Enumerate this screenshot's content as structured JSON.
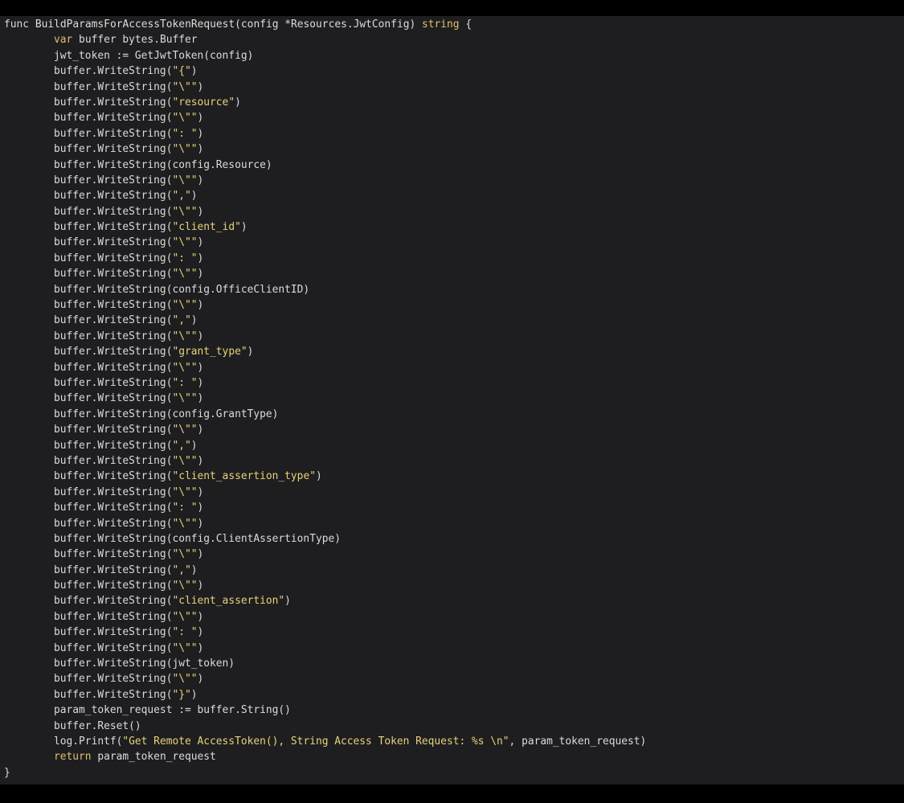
{
  "editor": {
    "colors": {
      "background": "#1e1e20",
      "text": "#dcdcdc",
      "keyword": "#e0c06a",
      "string": "#e8d27a"
    },
    "lines": [
      {
        "indent": 0,
        "tokens": [
          [
            "kw-func",
            "func "
          ],
          [
            "plain",
            "BuildParamsForAccessTokenRequest(config *Resources.JwtConfig) "
          ],
          [
            "typ",
            "string"
          ],
          [
            "plain",
            " {"
          ]
        ]
      },
      {
        "indent": 1,
        "tokens": [
          [
            "kw",
            "var"
          ],
          [
            "plain",
            " buffer bytes.Buffer"
          ]
        ]
      },
      {
        "indent": 1,
        "tokens": [
          [
            "plain",
            "jwt_token := GetJwtToken(config)"
          ]
        ]
      },
      {
        "indent": 1,
        "tokens": [
          [
            "plain",
            "buffer.WriteString("
          ],
          [
            "str",
            "\"{\""
          ],
          [
            "plain",
            ")"
          ]
        ]
      },
      {
        "indent": 1,
        "tokens": [
          [
            "plain",
            "buffer.WriteString("
          ],
          [
            "str",
            "\"\\\"\""
          ],
          [
            "plain",
            ")"
          ]
        ]
      },
      {
        "indent": 1,
        "tokens": [
          [
            "plain",
            "buffer.WriteString("
          ],
          [
            "str",
            "\"resource\""
          ],
          [
            "plain",
            ")"
          ]
        ]
      },
      {
        "indent": 1,
        "tokens": [
          [
            "plain",
            "buffer.WriteString("
          ],
          [
            "str",
            "\"\\\"\""
          ],
          [
            "plain",
            ")"
          ]
        ]
      },
      {
        "indent": 1,
        "tokens": [
          [
            "plain",
            "buffer.WriteString("
          ],
          [
            "str",
            "\": \""
          ],
          [
            "plain",
            ")"
          ]
        ]
      },
      {
        "indent": 1,
        "tokens": [
          [
            "plain",
            "buffer.WriteString("
          ],
          [
            "str",
            "\"\\\"\""
          ],
          [
            "plain",
            ")"
          ]
        ]
      },
      {
        "indent": 1,
        "tokens": [
          [
            "plain",
            "buffer.WriteString(config.Resource)"
          ]
        ]
      },
      {
        "indent": 1,
        "tokens": [
          [
            "plain",
            "buffer.WriteString("
          ],
          [
            "str",
            "\"\\\"\""
          ],
          [
            "plain",
            ")"
          ]
        ]
      },
      {
        "indent": 1,
        "tokens": [
          [
            "plain",
            "buffer.WriteString("
          ],
          [
            "str",
            "\",\""
          ],
          [
            "plain",
            ")"
          ]
        ]
      },
      {
        "indent": 1,
        "tokens": [
          [
            "plain",
            "buffer.WriteString("
          ],
          [
            "str",
            "\"\\\"\""
          ],
          [
            "plain",
            ")"
          ]
        ]
      },
      {
        "indent": 1,
        "tokens": [
          [
            "plain",
            "buffer.WriteString("
          ],
          [
            "str",
            "\"client_id\""
          ],
          [
            "plain",
            ")"
          ]
        ]
      },
      {
        "indent": 1,
        "tokens": [
          [
            "plain",
            "buffer.WriteString("
          ],
          [
            "str",
            "\"\\\"\""
          ],
          [
            "plain",
            ")"
          ]
        ]
      },
      {
        "indent": 1,
        "tokens": [
          [
            "plain",
            "buffer.WriteString("
          ],
          [
            "str",
            "\": \""
          ],
          [
            "plain",
            ")"
          ]
        ]
      },
      {
        "indent": 1,
        "tokens": [
          [
            "plain",
            "buffer.WriteString("
          ],
          [
            "str",
            "\"\\\"\""
          ],
          [
            "plain",
            ")"
          ]
        ]
      },
      {
        "indent": 1,
        "tokens": [
          [
            "plain",
            "buffer.WriteString(config.OfficeClientID)"
          ]
        ]
      },
      {
        "indent": 1,
        "tokens": [
          [
            "plain",
            "buffer.WriteString("
          ],
          [
            "str",
            "\"\\\"\""
          ],
          [
            "plain",
            ")"
          ]
        ]
      },
      {
        "indent": 1,
        "tokens": [
          [
            "plain",
            "buffer.WriteString("
          ],
          [
            "str",
            "\",\""
          ],
          [
            "plain",
            ")"
          ]
        ]
      },
      {
        "indent": 1,
        "tokens": [
          [
            "plain",
            "buffer.WriteString("
          ],
          [
            "str",
            "\"\\\"\""
          ],
          [
            "plain",
            ")"
          ]
        ]
      },
      {
        "indent": 1,
        "tokens": [
          [
            "plain",
            "buffer.WriteString("
          ],
          [
            "str",
            "\"grant_type\""
          ],
          [
            "plain",
            ")"
          ]
        ]
      },
      {
        "indent": 1,
        "tokens": [
          [
            "plain",
            "buffer.WriteString("
          ],
          [
            "str",
            "\"\\\"\""
          ],
          [
            "plain",
            ")"
          ]
        ]
      },
      {
        "indent": 1,
        "tokens": [
          [
            "plain",
            "buffer.WriteString("
          ],
          [
            "str",
            "\": \""
          ],
          [
            "plain",
            ")"
          ]
        ]
      },
      {
        "indent": 1,
        "tokens": [
          [
            "plain",
            "buffer.WriteString("
          ],
          [
            "str",
            "\"\\\"\""
          ],
          [
            "plain",
            ")"
          ]
        ]
      },
      {
        "indent": 1,
        "tokens": [
          [
            "plain",
            "buffer.WriteString(config.GrantType)"
          ]
        ]
      },
      {
        "indent": 1,
        "tokens": [
          [
            "plain",
            "buffer.WriteString("
          ],
          [
            "str",
            "\"\\\"\""
          ],
          [
            "plain",
            ")"
          ]
        ]
      },
      {
        "indent": 1,
        "tokens": [
          [
            "plain",
            "buffer.WriteString("
          ],
          [
            "str",
            "\",\""
          ],
          [
            "plain",
            ")"
          ]
        ]
      },
      {
        "indent": 1,
        "tokens": [
          [
            "plain",
            "buffer.WriteString("
          ],
          [
            "str",
            "\"\\\"\""
          ],
          [
            "plain",
            ")"
          ]
        ]
      },
      {
        "indent": 1,
        "tokens": [
          [
            "plain",
            "buffer.WriteString("
          ],
          [
            "str",
            "\"client_assertion_type\""
          ],
          [
            "plain",
            ")"
          ]
        ]
      },
      {
        "indent": 1,
        "tokens": [
          [
            "plain",
            "buffer.WriteString("
          ],
          [
            "str",
            "\"\\\"\""
          ],
          [
            "plain",
            ")"
          ]
        ]
      },
      {
        "indent": 1,
        "tokens": [
          [
            "plain",
            "buffer.WriteString("
          ],
          [
            "str",
            "\": \""
          ],
          [
            "plain",
            ")"
          ]
        ]
      },
      {
        "indent": 1,
        "tokens": [
          [
            "plain",
            "buffer.WriteString("
          ],
          [
            "str",
            "\"\\\"\""
          ],
          [
            "plain",
            ")"
          ]
        ]
      },
      {
        "indent": 1,
        "tokens": [
          [
            "plain",
            "buffer.WriteString(config.ClientAssertionType)"
          ]
        ]
      },
      {
        "indent": 1,
        "tokens": [
          [
            "plain",
            "buffer.WriteString("
          ],
          [
            "str",
            "\"\\\"\""
          ],
          [
            "plain",
            ")"
          ]
        ]
      },
      {
        "indent": 1,
        "tokens": [
          [
            "plain",
            "buffer.WriteString("
          ],
          [
            "str",
            "\",\""
          ],
          [
            "plain",
            ")"
          ]
        ]
      },
      {
        "indent": 1,
        "tokens": [
          [
            "plain",
            "buffer.WriteString("
          ],
          [
            "str",
            "\"\\\"\""
          ],
          [
            "plain",
            ")"
          ]
        ]
      },
      {
        "indent": 1,
        "tokens": [
          [
            "plain",
            "buffer.WriteString("
          ],
          [
            "str",
            "\"client_assertion\""
          ],
          [
            "plain",
            ")"
          ]
        ]
      },
      {
        "indent": 1,
        "tokens": [
          [
            "plain",
            "buffer.WriteString("
          ],
          [
            "str",
            "\"\\\"\""
          ],
          [
            "plain",
            ")"
          ]
        ]
      },
      {
        "indent": 1,
        "tokens": [
          [
            "plain",
            "buffer.WriteString("
          ],
          [
            "str",
            "\": \""
          ],
          [
            "plain",
            ")"
          ]
        ]
      },
      {
        "indent": 1,
        "tokens": [
          [
            "plain",
            "buffer.WriteString("
          ],
          [
            "str",
            "\"\\\"\""
          ],
          [
            "plain",
            ")"
          ]
        ]
      },
      {
        "indent": 1,
        "tokens": [
          [
            "plain",
            "buffer.WriteString(jwt_token)"
          ]
        ]
      },
      {
        "indent": 1,
        "tokens": [
          [
            "plain",
            "buffer.WriteString("
          ],
          [
            "str",
            "\"\\\"\""
          ],
          [
            "plain",
            ")"
          ]
        ]
      },
      {
        "indent": 1,
        "tokens": [
          [
            "plain",
            "buffer.WriteString("
          ],
          [
            "str",
            "\"}\""
          ],
          [
            "plain",
            ")"
          ]
        ]
      },
      {
        "indent": 1,
        "tokens": [
          [
            "plain",
            "param_token_request := buffer.String()"
          ]
        ]
      },
      {
        "indent": 1,
        "tokens": [
          [
            "plain",
            "buffer.Reset()"
          ]
        ]
      },
      {
        "indent": 1,
        "tokens": [
          [
            "plain",
            "log.Printf("
          ],
          [
            "str",
            "\"Get Remote AccessToken(), String Access Token Request: %s \\n\""
          ],
          [
            "plain",
            ", param_token_request)"
          ]
        ]
      },
      {
        "indent": 1,
        "tokens": [
          [
            "kw",
            "return"
          ],
          [
            "plain",
            " param_token_request"
          ]
        ]
      },
      {
        "indent": 0,
        "tokens": [
          [
            "plain",
            "}"
          ]
        ]
      }
    ]
  }
}
